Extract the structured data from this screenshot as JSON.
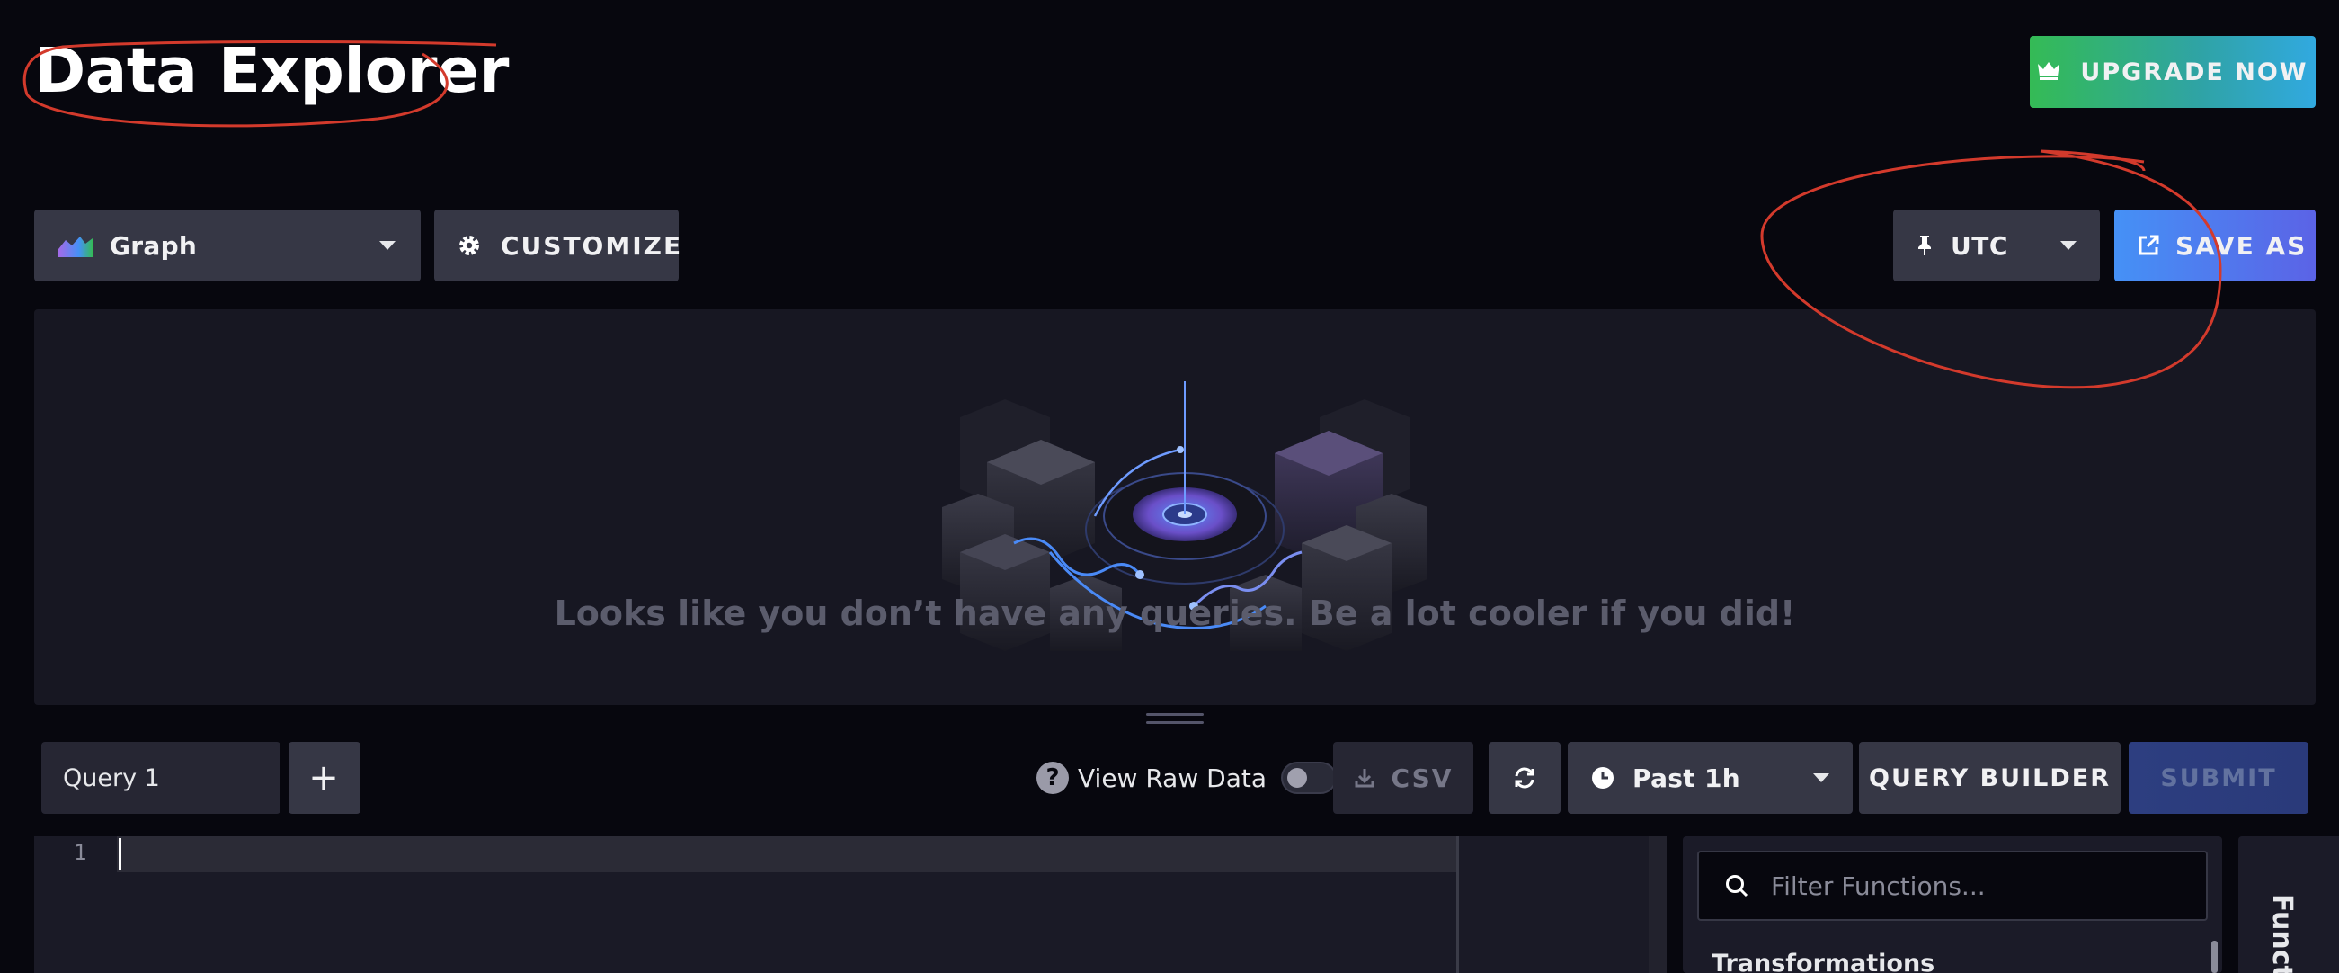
{
  "page": {
    "title": "Data Explorer"
  },
  "header": {
    "upgrade_label": "UPGRADE NOW"
  },
  "toolbar": {
    "graph_type": "Graph",
    "customize_label": "CUSTOMIZE",
    "timezone": "UTC",
    "save_as_label": "SAVE AS"
  },
  "empty_state": {
    "message": "Looks like you don’t have any queries. Be a lot cooler if you did!"
  },
  "query_bar": {
    "tab_label": "Query 1",
    "add_label": "+",
    "view_raw_label": "View Raw Data",
    "view_raw_enabled": false,
    "csv_label": "CSV",
    "time_range": "Past 1h",
    "query_builder_label": "QUERY BUILDER",
    "submit_label": "SUBMIT"
  },
  "editor": {
    "line_number": "1",
    "content": ""
  },
  "functions": {
    "search_placeholder": "Filter Functions...",
    "category": "Transformations",
    "side_tab_label": "Functi"
  },
  "colors": {
    "background": "#07070e",
    "upgrade_gradient_start": "#34bb55",
    "upgrade_gradient_end": "#31a9e0",
    "save_as_blue": "#4591f6",
    "annotation_red": "#d33a2c"
  }
}
